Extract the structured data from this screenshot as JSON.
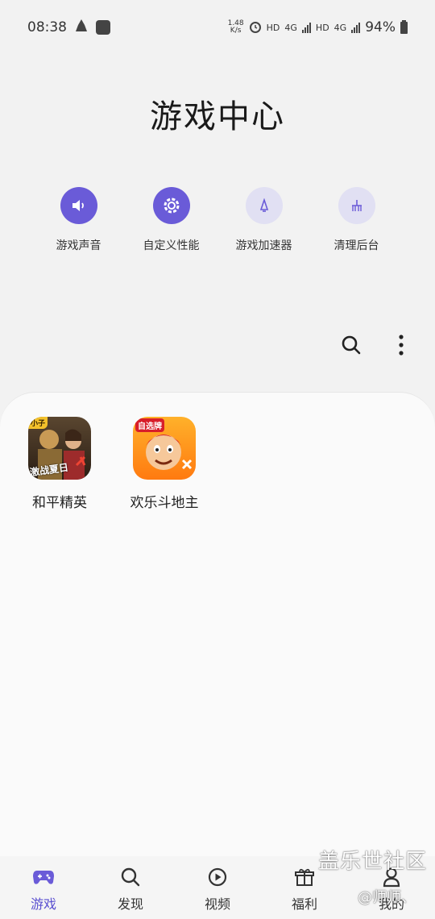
{
  "status_bar": {
    "time": "08:38",
    "net_speed_value": "1.48",
    "net_speed_unit": "K/s",
    "hd1": "HD",
    "net1": "4G",
    "hd2": "HD",
    "net2": "4G",
    "battery": "94%"
  },
  "title": "游戏中心",
  "quick_tools": [
    {
      "label": "游戏声音",
      "icon": "speaker-icon",
      "active": true
    },
    {
      "label": "自定义性能",
      "icon": "gear-icon",
      "active": true
    },
    {
      "label": "游戏加速器",
      "icon": "rocket-icon",
      "active": false
    },
    {
      "label": "清理后台",
      "icon": "broom-icon",
      "active": false
    }
  ],
  "games": [
    {
      "name": "和平精英",
      "icon_text": "激战夏日",
      "badge": "小子"
    },
    {
      "name": "欢乐斗地主",
      "icon_text": "自选牌"
    }
  ],
  "bottom_nav": [
    {
      "label": "游戏",
      "icon": "gamepad-icon",
      "active": true
    },
    {
      "label": "发现",
      "icon": "search-icon",
      "active": false
    },
    {
      "label": "视频",
      "icon": "play-icon",
      "active": false
    },
    {
      "label": "福利",
      "icon": "gift-icon",
      "active": false
    },
    {
      "label": "我的",
      "icon": "person-icon",
      "active": false
    }
  ],
  "watermark": {
    "main": "盖乐世社区",
    "sub": "@师师、"
  },
  "colors": {
    "accent": "#6a5bd8",
    "accent_light": "#e1e0f3",
    "background": "#f2f2f2",
    "card": "#fafafa"
  }
}
